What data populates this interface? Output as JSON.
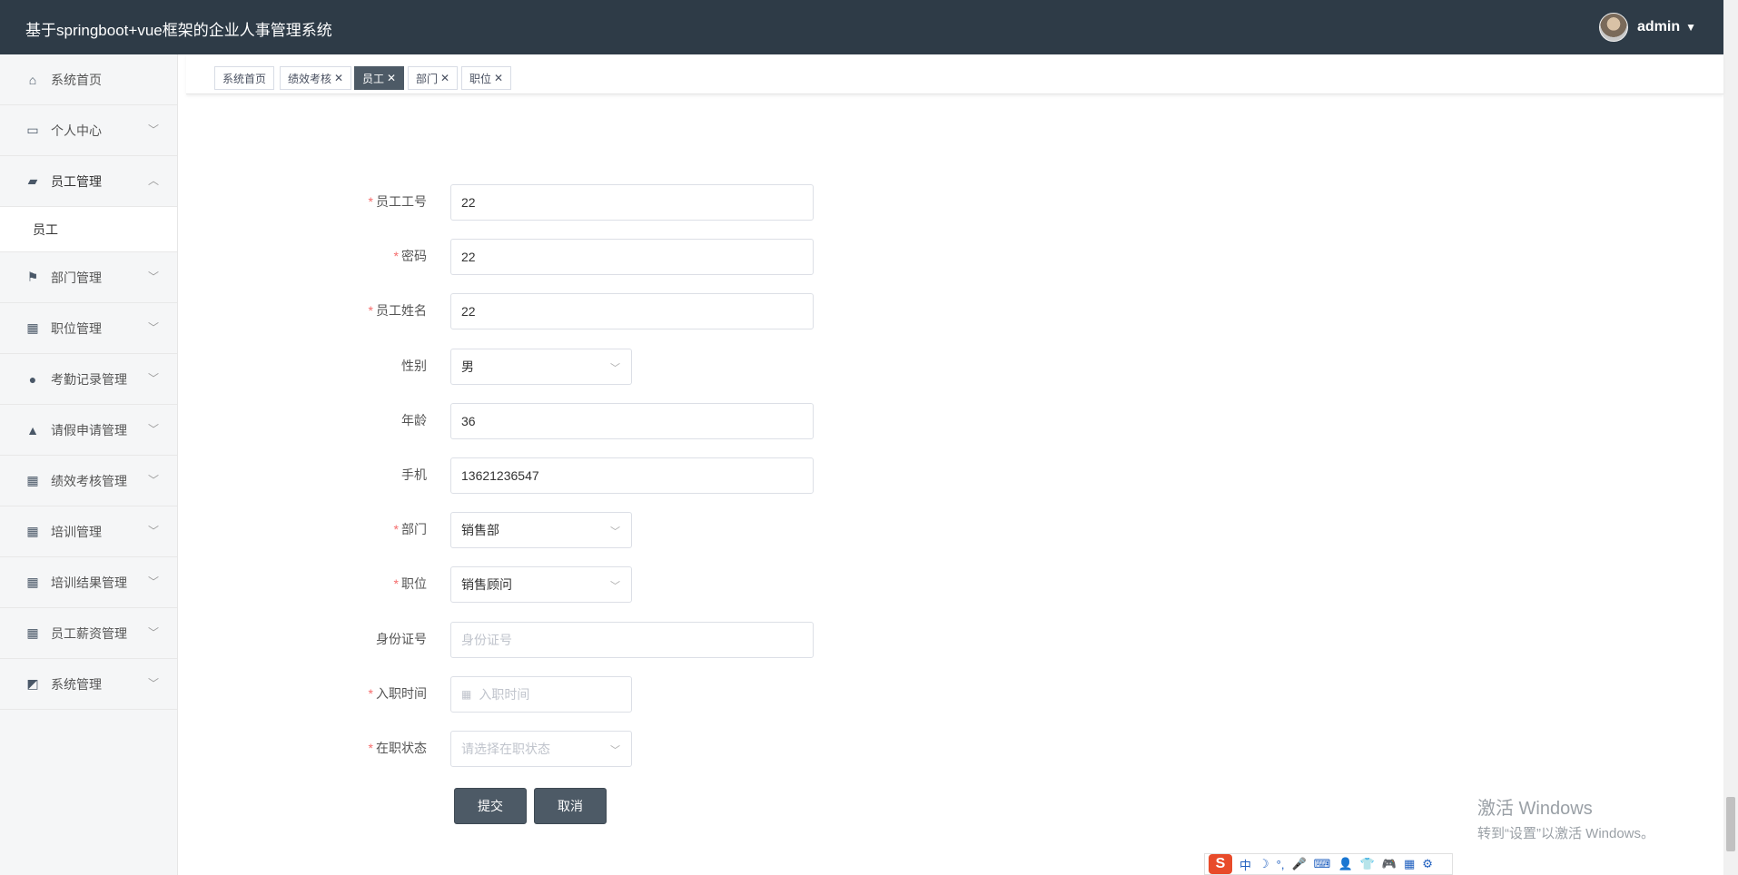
{
  "header": {
    "title": "基于springboot+vue框架的企业人事管理系统",
    "username": "admin"
  },
  "sidebar": {
    "items": [
      {
        "label": "系统首页",
        "icon": "home-icon",
        "arrow": ""
      },
      {
        "label": "个人中心",
        "icon": "card-icon",
        "arrow": "﹀"
      },
      {
        "label": "员工管理",
        "icon": "ticket-icon",
        "arrow": "︿"
      },
      {
        "label": "员工",
        "sub": true
      },
      {
        "label": "部门管理",
        "icon": "flag-icon",
        "arrow": "﹀"
      },
      {
        "label": "职位管理",
        "icon": "grid-icon",
        "arrow": "﹀"
      },
      {
        "label": "考勤记录管理",
        "icon": "user-icon",
        "arrow": "﹀"
      },
      {
        "label": "请假申请管理",
        "icon": "thumb-icon",
        "arrow": "﹀"
      },
      {
        "label": "绩效考核管理",
        "icon": "grid-icon",
        "arrow": "﹀"
      },
      {
        "label": "培训管理",
        "icon": "grid-icon",
        "arrow": "﹀"
      },
      {
        "label": "培训结果管理",
        "icon": "grid-icon",
        "arrow": "﹀"
      },
      {
        "label": "员工薪资管理",
        "icon": "grid-icon",
        "arrow": "﹀"
      },
      {
        "label": "系统管理",
        "icon": "chart-icon",
        "arrow": "﹀"
      }
    ]
  },
  "tabs": [
    {
      "label": "系统首页",
      "closable": false,
      "active": false
    },
    {
      "label": "绩效考核",
      "closable": true,
      "active": false
    },
    {
      "label": "员工",
      "closable": true,
      "active": true
    },
    {
      "label": "部门",
      "closable": true,
      "active": false
    },
    {
      "label": "职位",
      "closable": true,
      "active": false
    }
  ],
  "form": {
    "fields": [
      {
        "label": "员工工号",
        "required": true,
        "value": "22",
        "type": "text"
      },
      {
        "label": "密码",
        "required": true,
        "value": "22",
        "type": "text"
      },
      {
        "label": "员工姓名",
        "required": true,
        "value": "22",
        "type": "text"
      },
      {
        "label": "性别",
        "required": false,
        "value": "男",
        "type": "select"
      },
      {
        "label": "年龄",
        "required": false,
        "value": "36",
        "type": "text"
      },
      {
        "label": "手机",
        "required": false,
        "value": "13621236547",
        "type": "text"
      },
      {
        "label": "部门",
        "required": true,
        "value": "销售部",
        "type": "select"
      },
      {
        "label": "职位",
        "required": true,
        "value": "销售顾问",
        "type": "select"
      },
      {
        "label": "身份证号",
        "required": false,
        "placeholder": "身份证号",
        "type": "text"
      },
      {
        "label": "入职时间",
        "required": true,
        "placeholder": "入职时间",
        "type": "date"
      },
      {
        "label": "在职状态",
        "required": true,
        "placeholder": "请选择在职状态",
        "type": "select"
      }
    ],
    "submit_label": "提交",
    "cancel_label": "取消"
  },
  "watermark": {
    "line1": "激活 Windows",
    "line2": "转到“设置”以激活 Windows。"
  },
  "ime": {
    "logo": "S",
    "mode": "中",
    "glyphs": [
      "☽",
      "°,",
      "🎤",
      "⌨",
      "👤",
      "👕",
      "🎮",
      "▦",
      "⚙"
    ]
  },
  "colors": {
    "header_bg": "#2e3b47",
    "accent": "#4d5a66",
    "required": "#f56c6c"
  }
}
